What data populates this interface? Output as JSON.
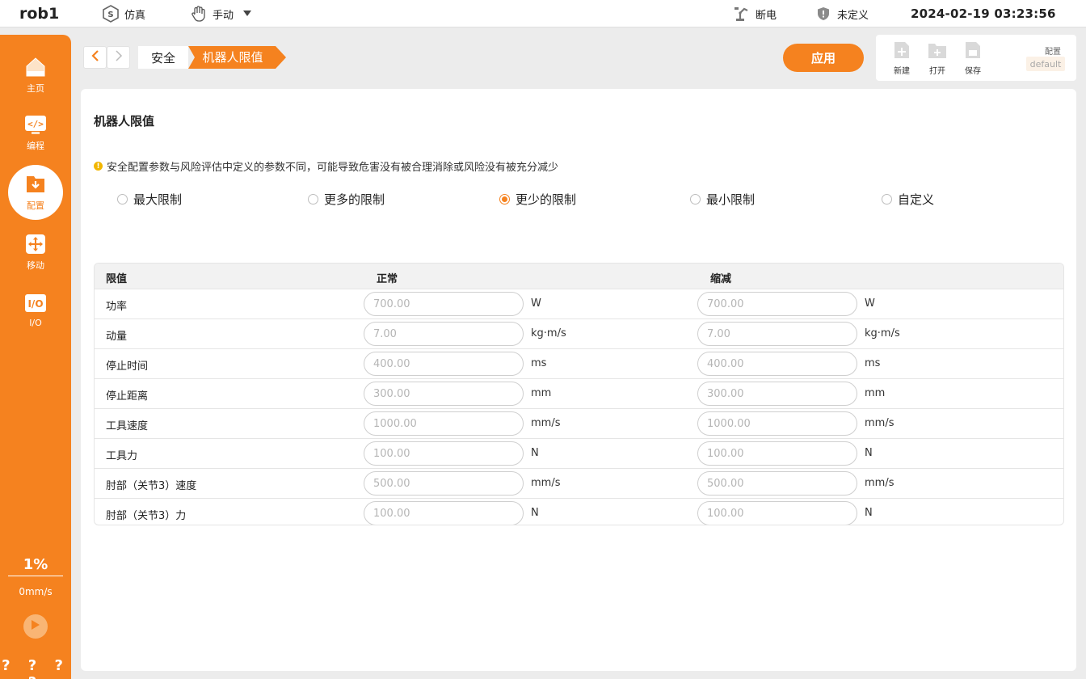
{
  "topbar": {
    "robot_name": "rob1",
    "mode_label": "仿真",
    "control_label": "手动",
    "power_label": "断电",
    "safety_label": "未定义",
    "datetime": "2024-02-19 03:23:56"
  },
  "sidebar": {
    "items": [
      {
        "label": "主页",
        "icon": "home-icon"
      },
      {
        "label": "编程",
        "icon": "code-icon"
      },
      {
        "label": "配置",
        "icon": "config-icon",
        "active": true
      },
      {
        "label": "移动",
        "icon": "move-icon"
      },
      {
        "label": "I/O",
        "icon": "io-icon"
      }
    ],
    "speed_percent": "1%",
    "speed_value": "0mm/s",
    "status_marks": "? ? ? ?"
  },
  "breadcrumb": {
    "items": [
      "安全",
      "机器人限值"
    ]
  },
  "toolbar": {
    "apply_label": "应用",
    "new_label": "新建",
    "open_label": "打开",
    "save_label": "保存",
    "config_label": "配置",
    "config_value": "default"
  },
  "main": {
    "title": "机器人限值",
    "warning": "安全配置参数与风险评估中定义的参数不同，可能导致危害没有被合理消除或风险没有被充分减少",
    "options": [
      {
        "label": "最大限制",
        "checked": false
      },
      {
        "label": "更多的限制",
        "checked": false
      },
      {
        "label": "更少的限制",
        "checked": true
      },
      {
        "label": "最小限制",
        "checked": false
      },
      {
        "label": "自定义",
        "checked": false
      }
    ],
    "table": {
      "headers": [
        "限值",
        "正常",
        "缩减"
      ],
      "rows": [
        {
          "label": "功率",
          "normal": "700.00",
          "normal_unit": " W",
          "reduced": "700.00",
          "reduced_unit": "W"
        },
        {
          "label": "动量",
          "normal": "7.00",
          "normal_unit": "kg·m/s",
          "reduced": "7.00",
          "reduced_unit": "kg·m/s"
        },
        {
          "label": "停止时间",
          "normal": "400.00",
          "normal_unit": "ms",
          "reduced": "400.00",
          "reduced_unit": "ms"
        },
        {
          "label": "停止距离",
          "normal": "300.00",
          "normal_unit": "mm",
          "reduced": "300.00",
          "reduced_unit": "mm"
        },
        {
          "label": "工具速度",
          "normal": "1000.00",
          "normal_unit": "mm/s",
          "reduced": "1000.00",
          "reduced_unit": "mm/s"
        },
        {
          "label": "工具力",
          "normal": "100.00",
          "normal_unit": "N",
          "reduced": "100.00",
          "reduced_unit": "N"
        },
        {
          "label": "肘部（关节3）速度",
          "normal": "500.00",
          "normal_unit": "mm/s",
          "reduced": "500.00",
          "reduced_unit": "mm/s"
        },
        {
          "label": "肘部（关节3）力",
          "normal": "100.00",
          "normal_unit": "N",
          "reduced": "100.00",
          "reduced_unit": "N"
        }
      ]
    }
  },
  "colors": {
    "accent": "#f5821f",
    "warning": "#f2b600"
  }
}
